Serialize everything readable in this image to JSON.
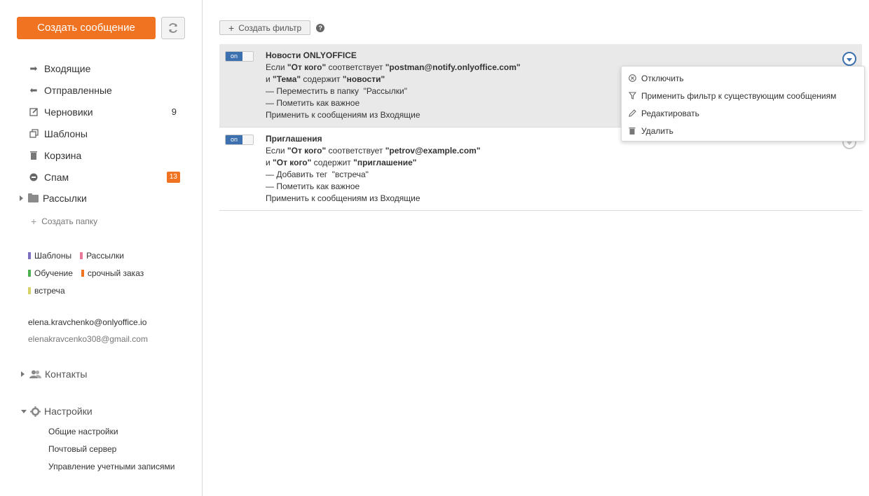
{
  "sidebar": {
    "compose_label": "Создать сообщение",
    "folders": [
      {
        "label": "Входящие",
        "icon": "inbox-arrow-icon",
        "count": ""
      },
      {
        "label": "Отправленные",
        "icon": "reply-icon",
        "count": ""
      },
      {
        "label": "Черновики",
        "icon": "pencil-square-icon",
        "count": "9"
      },
      {
        "label": "Шаблоны",
        "icon": "copy-icon",
        "count": ""
      },
      {
        "label": "Корзина",
        "icon": "trash-icon",
        "count": ""
      },
      {
        "label": "Спам",
        "icon": "minus-circle-icon",
        "badge": "13"
      }
    ],
    "mailings_label": "Рассылки",
    "create_folder_label": "Создать папку",
    "tags": [
      {
        "label": "Шаблоны",
        "color": "#7b6fbf"
      },
      {
        "label": "Рассылки",
        "color": "#e8789a"
      },
      {
        "label": "Обучение",
        "color": "#4caf50"
      },
      {
        "label": "срочный заказ",
        "color": "#f07321"
      },
      {
        "label": "встреча",
        "color": "#d7d26a"
      }
    ],
    "accounts": [
      "elena.kravchenko@onlyoffice.io",
      "elenakravcenko308@gmail.com"
    ],
    "contacts_label": "Контакты",
    "settings_label": "Настройки",
    "settings_items": [
      "Общие настройки",
      "Почтовый сервер",
      "Управление учетными записями"
    ]
  },
  "toolbar": {
    "create_filter_label": "Создать фильтр"
  },
  "filters": [
    {
      "toggle": "on",
      "title": "Новости ONLYOFFICE",
      "line1": {
        "if": "Если",
        "field": "\"От кого\"",
        "cond": "соответствует",
        "value": "\"postman@notify.onlyoffice.com\""
      },
      "line2": {
        "and": "и",
        "field": "\"Тема\"",
        "cond": "содержит",
        "value": "\"новости\""
      },
      "action1": "— Переместить в папку  \"Рассылки\"",
      "action2": "— Пометить как важное",
      "apply": "Применить к сообщениям из Входящие"
    },
    {
      "toggle": "on",
      "title": "Приглашения",
      "line1": {
        "if": "Если",
        "field": "\"От кого\"",
        "cond": "соответствует",
        "value": "\"petrov@example.com\""
      },
      "line2": {
        "and": "и",
        "field": "\"От кого\"",
        "cond": "содержит",
        "value": "\"приглашение\""
      },
      "action1": "— Добавить тег  \"встреча\"",
      "action2": "— Пометить как важное",
      "apply": "Применить к сообщениям из Входящие"
    }
  ],
  "dropdown": {
    "items": [
      {
        "label": "Отключить",
        "icon": "disable-circle-icon"
      },
      {
        "label": "Применить фильтр к существующим сообщениям",
        "icon": "funnel-icon"
      },
      {
        "label": "Редактировать",
        "icon": "pencil-icon"
      },
      {
        "label": "Удалить",
        "icon": "trash-icon"
      }
    ]
  },
  "colors": {
    "accent": "#f07321",
    "toggle_on": "#3d70ae"
  }
}
